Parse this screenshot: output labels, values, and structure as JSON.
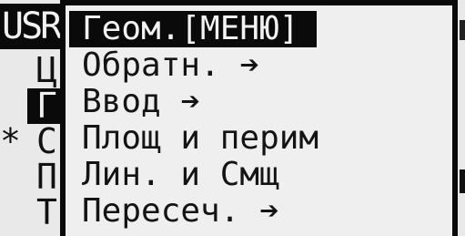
{
  "background_screen": {
    "title": "USR",
    "rows": [
      {
        "marker": "",
        "letter": "Ц",
        "selected": false
      },
      {
        "marker": "",
        "letter": "Г",
        "selected": true
      },
      {
        "marker": "*",
        "letter": "С",
        "selected": false
      },
      {
        "marker": "",
        "letter": "П",
        "selected": false
      },
      {
        "marker": "",
        "letter": "Т",
        "selected": false
      }
    ]
  },
  "menu": {
    "items": [
      {
        "label": "Геом.[МЕНЮ]",
        "selected": true
      },
      {
        "label": "Обратн. ➔",
        "selected": false
      },
      {
        "label": "Ввод ➔",
        "selected": false
      },
      {
        "label": "Площ и перим",
        "selected": false
      },
      {
        "label": "Лин. и Смщ",
        "selected": false
      },
      {
        "label": "Пересеч. ➔",
        "selected": false
      }
    ]
  }
}
